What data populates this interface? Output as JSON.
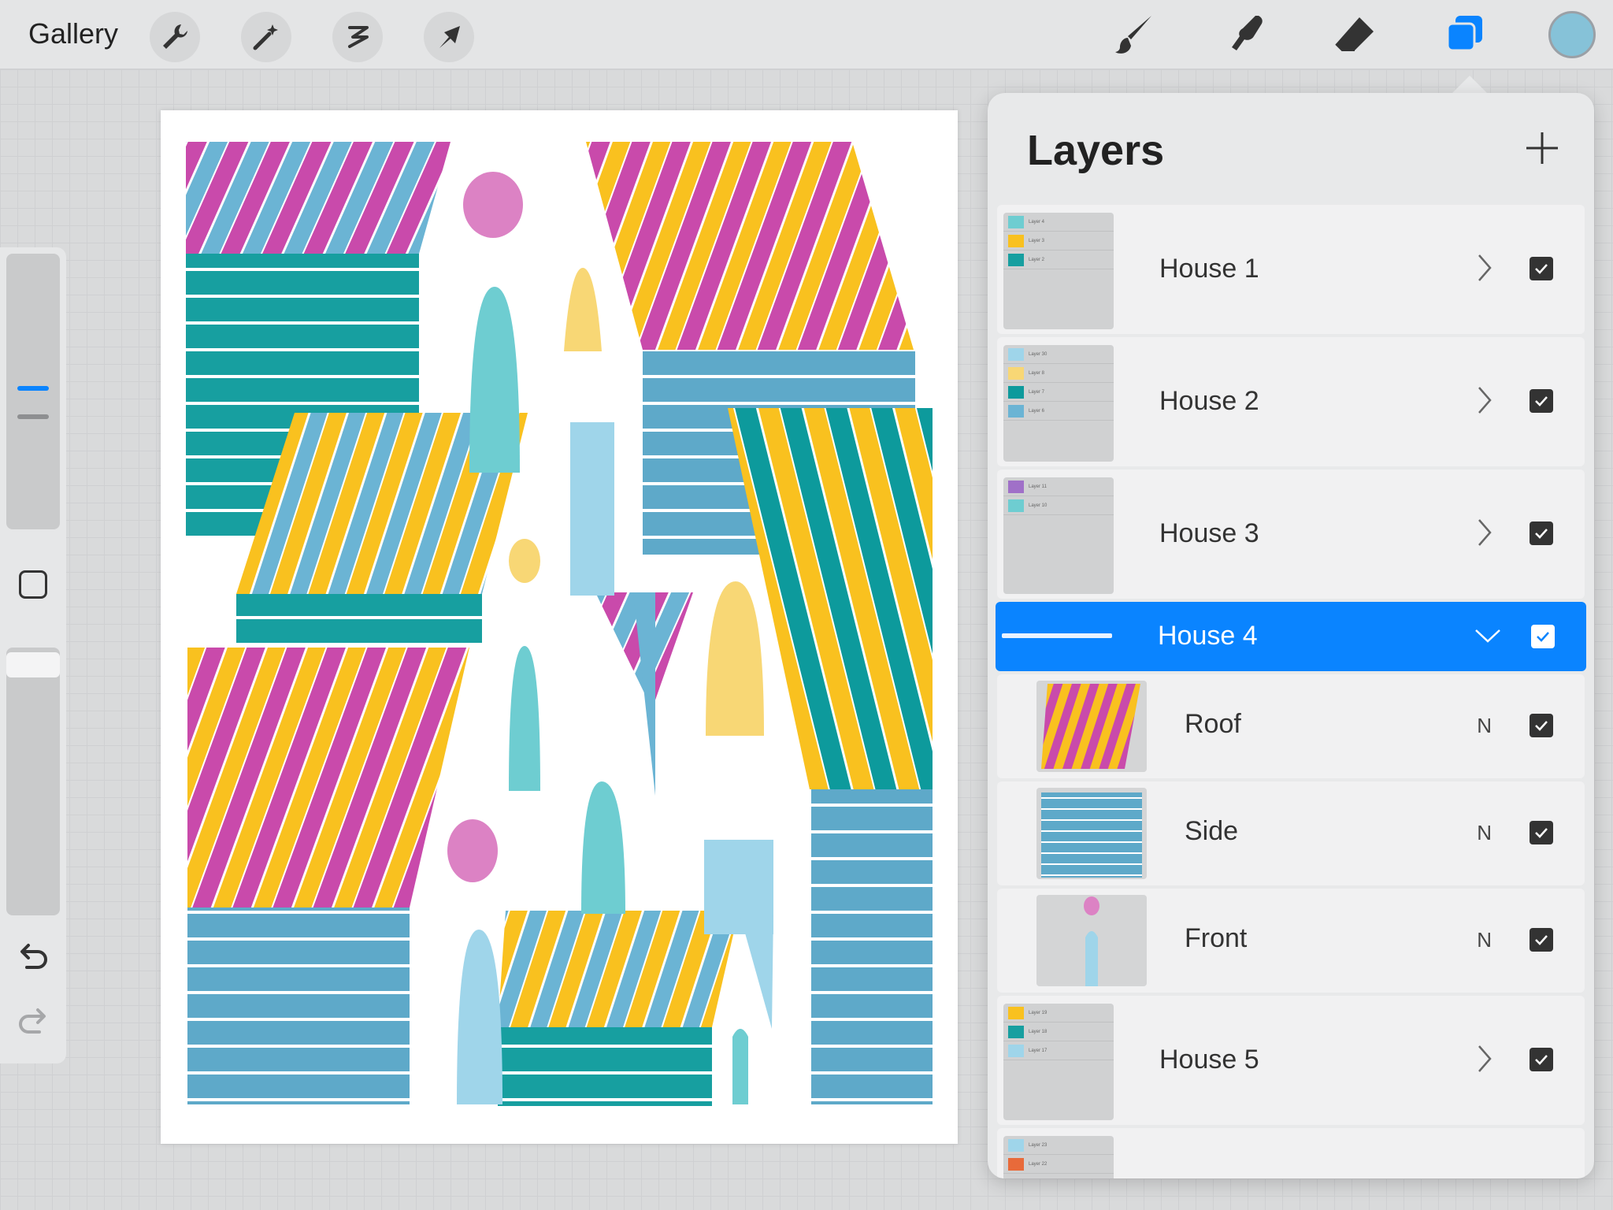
{
  "topbar": {
    "gallery_label": "Gallery",
    "tools_left": [
      "wrench-icon",
      "magic-wand-icon",
      "selection-icon",
      "transform-arrow-icon"
    ],
    "tools_right": [
      "brush-icon",
      "smudge-icon",
      "eraser-icon",
      "layers-icon"
    ],
    "color_swatch": "#86c2d8"
  },
  "sidebar": {
    "undo_icon": "undo-icon",
    "redo_icon": "redo-icon"
  },
  "colors": {
    "magenta": "#c94aab",
    "yellow": "#f9c11f",
    "teal": "#0d9a9c",
    "blue": "#6bb4d4",
    "accent": "#0a84ff"
  },
  "layers": {
    "title": "Layers",
    "add_icon": "plus-icon",
    "items": [
      {
        "label": "House 1",
        "mini_labels": [
          "Layer 4",
          "Layer 3",
          "Layer 2"
        ]
      },
      {
        "label": "House 2",
        "mini_labels": [
          "Layer 30",
          "Layer 8",
          "Layer 7",
          "Layer 6"
        ]
      },
      {
        "label": "House 3",
        "mini_labels": [
          "Layer 11",
          "Layer 10"
        ]
      },
      {
        "label": "House 4",
        "selected": true,
        "children": [
          {
            "label": "Roof",
            "blend": "N"
          },
          {
            "label": "Side",
            "blend": "N"
          },
          {
            "label": "Front",
            "blend": "N"
          }
        ]
      },
      {
        "label": "House 5",
        "mini_labels": [
          "Layer 19",
          "Layer 18",
          "Layer 17"
        ]
      },
      {
        "label": "",
        "mini_labels": [
          "Layer 23",
          "Layer 22"
        ]
      }
    ]
  }
}
